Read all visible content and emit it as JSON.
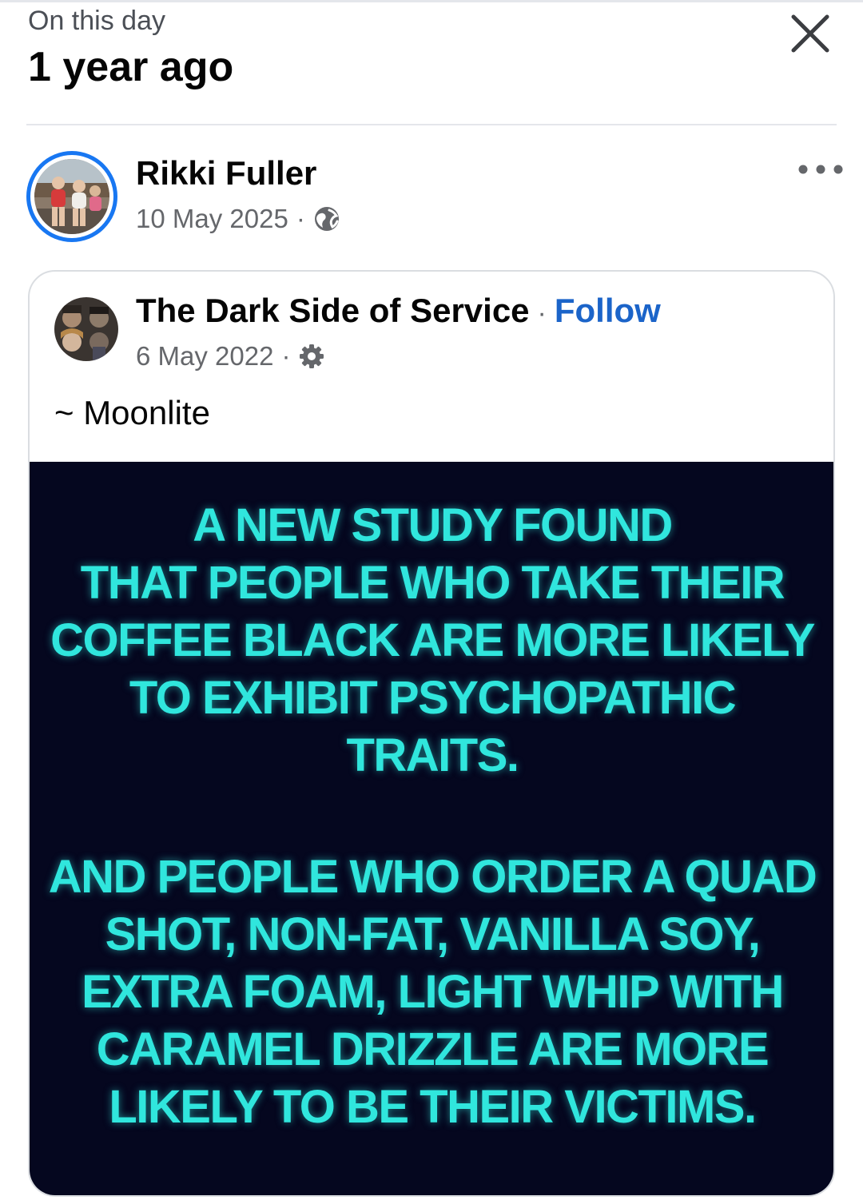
{
  "header": {
    "kicker": "On this day",
    "title": "1 year ago"
  },
  "post": {
    "author": "Rikki Fuller",
    "date": "10 May 2025",
    "separator": "·",
    "privacy_icon": "globe-icon",
    "more_icon": "more-options-icon"
  },
  "shared_post": {
    "page_name": "The Dark Side of Service",
    "separator": "·",
    "follow_label": "Follow",
    "date": "6 May 2022",
    "privacy_icon": "gear-icon",
    "caption": "~ Moonlite"
  },
  "meme": {
    "block1": [
      "A NEW STUDY FOUND",
      "THAT PEOPLE WHO TAKE THEIR",
      "COFFEE BLACK ARE MORE LIKELY",
      "TO EXHIBIT PSYCHOPATHIC",
      "TRAITS."
    ],
    "block2": [
      "AND PEOPLE WHO ORDER A QUAD",
      "SHOT, NON-FAT, VANILLA SOY,",
      "EXTRA FOAM, LIGHT WHIP WITH",
      "CARAMEL DRIZZLE ARE MORE",
      "LIKELY TO BE THEIR VICTIMS."
    ]
  },
  "colors": {
    "link": "#1b64c9",
    "avatar_ring": "#1877f2",
    "meme_background": "#05071f",
    "meme_text": "#30e6dd"
  }
}
